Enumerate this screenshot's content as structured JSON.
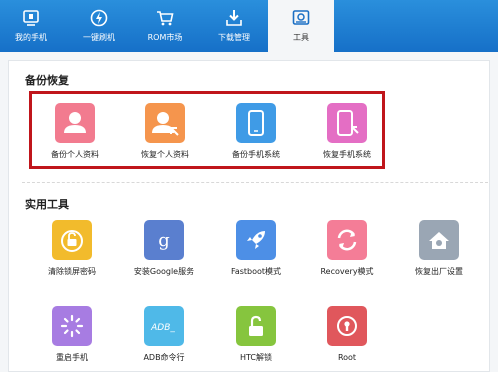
{
  "nav": {
    "items": [
      {
        "label": "我的手机",
        "icon": "phone-monitor-icon"
      },
      {
        "label": "一键刷机",
        "icon": "lightning-refresh-icon"
      },
      {
        "label": "ROM市场",
        "icon": "shopping-cart-icon"
      },
      {
        "label": "下载管理",
        "icon": "download-tray-icon"
      },
      {
        "label": "工具",
        "icon": "toolbox-icon",
        "active": true
      }
    ]
  },
  "backup": {
    "title": "备份恢复",
    "items": [
      {
        "label": "备份个人资料",
        "icon": "user-backup-icon",
        "color": "#f27b8f"
      },
      {
        "label": "恢复个人资料",
        "icon": "user-restore-icon",
        "color": "#f5954d"
      },
      {
        "label": "备份手机系统",
        "icon": "phone-backup-icon",
        "color": "#3f9be6"
      },
      {
        "label": "恢复手机系统",
        "icon": "phone-restore-icon",
        "color": "#e46ec4"
      }
    ]
  },
  "tools": {
    "title": "实用工具",
    "items": [
      {
        "label": "清除锁屏密码",
        "icon": "unlock-screen-icon",
        "color": "#f2bb2c"
      },
      {
        "label": "安装Google服务",
        "icon": "google-icon",
        "color": "#5a7fcf"
      },
      {
        "label": "Fastboot模式",
        "icon": "rocket-icon",
        "color": "#4d8fe6"
      },
      {
        "label": "Recovery模式",
        "icon": "recovery-arrows-icon",
        "color": "#f47d97"
      },
      {
        "label": "恢复出厂设置",
        "icon": "factory-home-icon",
        "color": "#9aa6b4"
      },
      {
        "label": "重启手机",
        "icon": "restart-loader-icon",
        "color": "#a77ce2"
      },
      {
        "label": "ADB命令行",
        "icon": "adb-terminal-icon",
        "color": "#4fb9e8"
      },
      {
        "label": "HTC解锁",
        "icon": "htc-unlock-icon",
        "color": "#86c53e"
      },
      {
        "label": "Root",
        "icon": "root-keyhole-icon",
        "color": "#e0575c"
      }
    ]
  }
}
